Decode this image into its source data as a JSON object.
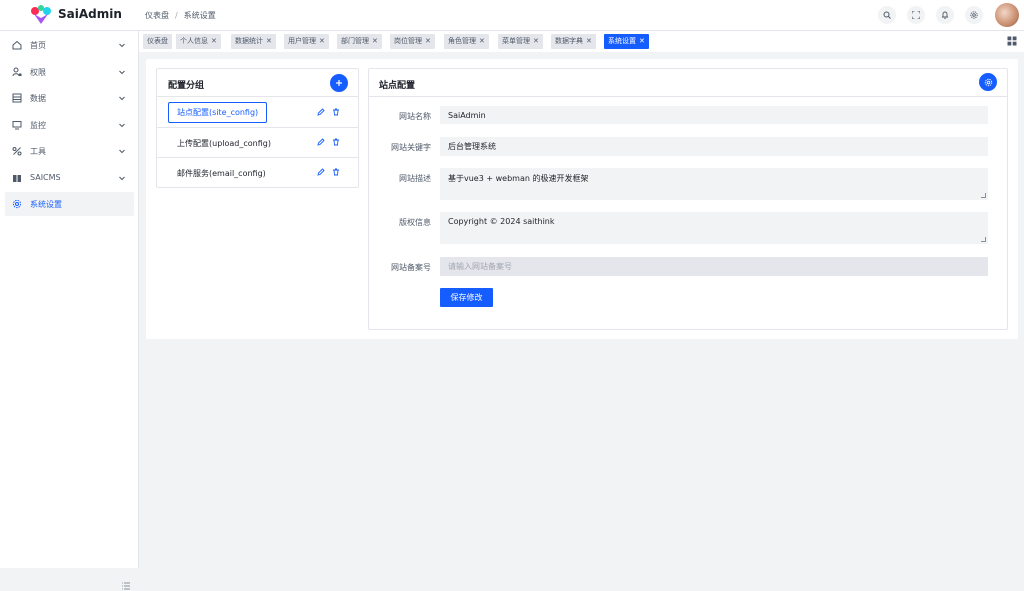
{
  "brand": {
    "name": "SaiAdmin"
  },
  "breadcrumb": {
    "home": "仪表盘",
    "separator": "/",
    "current": "系统设置"
  },
  "header_actions": [
    "search-icon",
    "fullscreen-icon",
    "bell-icon",
    "settings-icon"
  ],
  "sidebar": {
    "items": [
      {
        "label": "首页",
        "icon": "home-icon",
        "expandable": true
      },
      {
        "label": "权限",
        "icon": "user-lock-icon",
        "expandable": true
      },
      {
        "label": "数据",
        "icon": "database-icon",
        "expandable": true
      },
      {
        "label": "监控",
        "icon": "monitor-icon",
        "expandable": true
      },
      {
        "label": "工具",
        "icon": "tool-icon",
        "expandable": true
      },
      {
        "label": "SAICMS",
        "icon": "book-icon",
        "expandable": true
      },
      {
        "label": "系统设置",
        "icon": "gear-icon",
        "expandable": false,
        "active": true
      }
    ]
  },
  "tabs": [
    {
      "label": "仪表盘",
      "closable": false
    },
    {
      "label": "个人信息",
      "closable": true
    },
    {
      "label": "数据统计",
      "closable": true
    },
    {
      "label": "用户管理",
      "closable": true
    },
    {
      "label": "部门管理",
      "closable": true
    },
    {
      "label": "岗位管理",
      "closable": true
    },
    {
      "label": "角色管理",
      "closable": true
    },
    {
      "label": "菜单管理",
      "closable": true
    },
    {
      "label": "数据字典",
      "closable": true
    },
    {
      "label": "系统设置",
      "closable": true,
      "active": true
    }
  ],
  "close_glyph": "✕",
  "config_group": {
    "title": "配置分组",
    "items": [
      {
        "label": "站点配置(site_config)",
        "selected": true
      },
      {
        "label": "上传配置(upload_config)",
        "selected": false
      },
      {
        "label": "邮件服务(email_config)",
        "selected": false
      }
    ]
  },
  "site_config": {
    "title": "站点配置",
    "fields": {
      "site_name": {
        "label": "网站名称",
        "value": "SaiAdmin"
      },
      "site_keywords": {
        "label": "网站关键字",
        "value": "后台管理系统"
      },
      "site_desc": {
        "label": "网站描述",
        "value": "基于vue3 + webman 的极速开发框架"
      },
      "copyright": {
        "label": "版权信息",
        "value": "Copyright © 2024 saithink"
      },
      "record_no": {
        "label": "网站备案号",
        "placeholder": "请输入网站备案号"
      }
    },
    "save_label": "保存修改"
  },
  "colors": {
    "primary": "#165dff",
    "bg": "#f2f3f5",
    "border": "#e5e6eb",
    "text": "#1d2129",
    "muted": "#4e5969"
  }
}
